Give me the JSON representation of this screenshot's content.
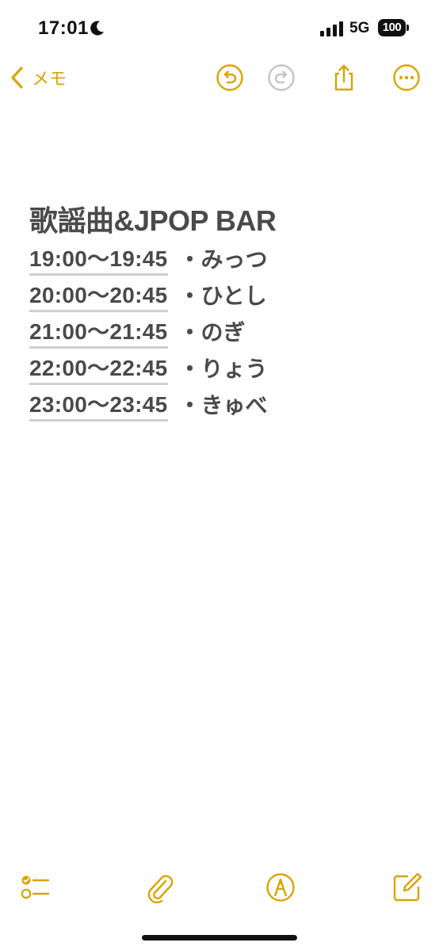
{
  "status_bar": {
    "time": "17:01",
    "network": "5G",
    "battery": "100"
  },
  "nav": {
    "back_label": "メモ"
  },
  "note": {
    "title": "歌謡曲&JPOP BAR",
    "entries": [
      {
        "time": "19:00〜19:45",
        "name": "・みっつ"
      },
      {
        "time": "20:00〜20:45",
        "name": "・ひとし"
      },
      {
        "time": "21:00〜21:45",
        "name": "・のぎ"
      },
      {
        "time": "22:00〜22:45",
        "name": "・りょう"
      },
      {
        "time": "23:00〜23:45",
        "name": "・きゅべ"
      }
    ]
  },
  "icons": {
    "back": "chevron-left-icon",
    "undo": "undo-icon",
    "redo": "redo-icon",
    "share": "share-icon",
    "more": "more-icon",
    "checklist": "checklist-icon",
    "attach": "paperclip-icon",
    "markup": "markup-pen-icon",
    "compose": "compose-icon"
  },
  "colors": {
    "accent": "#d9a400",
    "text": "#4a4a4a",
    "disabled": "#c4c4c4"
  }
}
